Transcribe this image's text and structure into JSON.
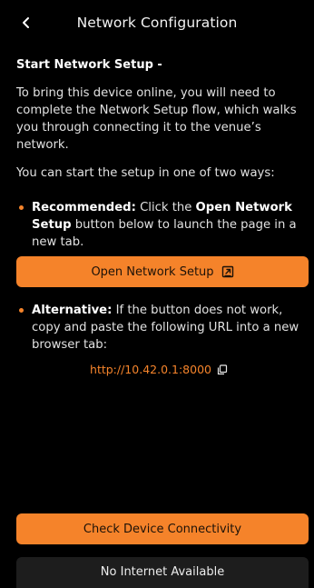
{
  "header": {
    "title": "Network Configuration",
    "back_icon": "chevron-left-icon"
  },
  "setup": {
    "heading": "Start Network Setup -",
    "intro": "To bring this device online, you will need to complete the Network Setup flow, which walks you through connecting it to the venue’s network.",
    "ways": "You can start the setup in one of two ways:",
    "recommended": {
      "label": "Recommended:",
      "text_before": " Click the ",
      "button_ref": "Open Network Setup",
      "text_after": " button below to launch the page in a new tab."
    },
    "open_button_label": "Open Network Setup",
    "open_button_icon": "external-link-icon",
    "alternative": {
      "label": "Alternative:",
      "text": " If the button does not work, copy and paste the following URL into a new browser tab:"
    },
    "url": "http://10.42.0.1:8000",
    "copy_icon": "copy-icon"
  },
  "footer": {
    "check_button_label": "Check Device Connectivity",
    "status_button_label": "No Internet Available"
  },
  "colors": {
    "accent": "#f5832a",
    "background": "#000000",
    "secondary_button": "#1d1d1d"
  }
}
